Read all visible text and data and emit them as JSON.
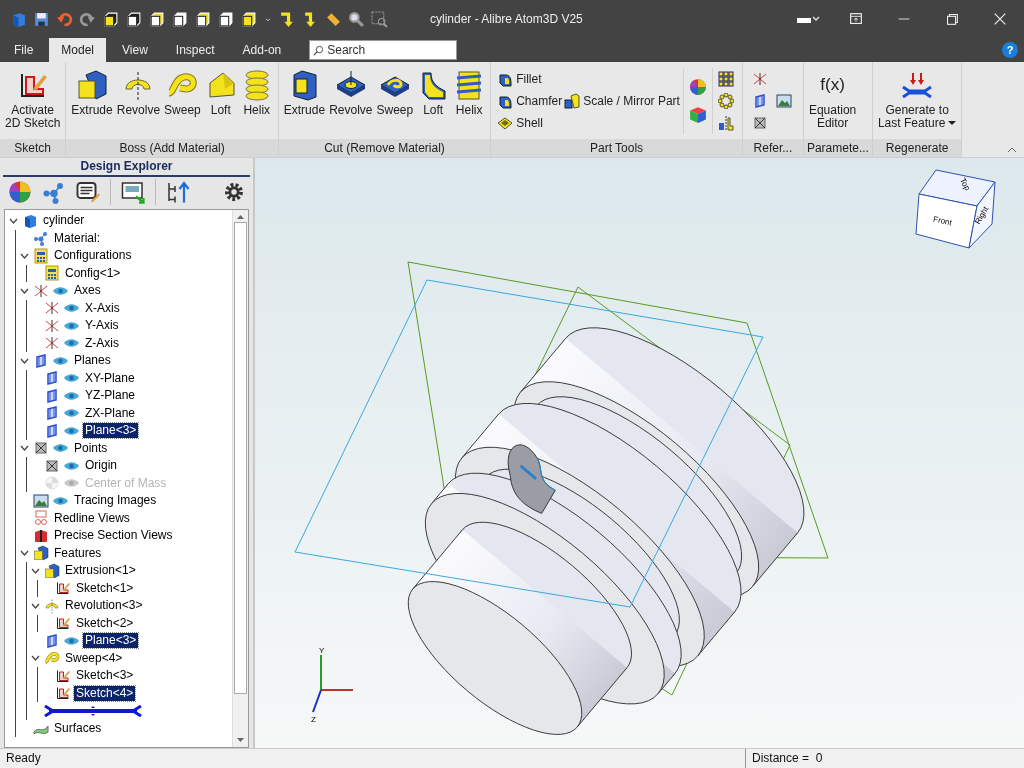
{
  "window": {
    "title": "cylinder - Alibre Atom3D V25"
  },
  "menu_tabs": [
    {
      "label": "File",
      "selected": false
    },
    {
      "label": "Model",
      "selected": true
    },
    {
      "label": "View",
      "selected": false
    },
    {
      "label": "Inspect",
      "selected": false
    },
    {
      "label": "Add-on",
      "selected": false
    }
  ],
  "search": {
    "placeholder": "Search"
  },
  "help": {
    "label": "?"
  },
  "ribbon_groups": [
    {
      "label": "Sketch",
      "kind": "large",
      "buttons": [
        {
          "label": "Activate\n2D Sketch"
        }
      ]
    },
    {
      "label": "Boss (Add Material)",
      "kind": "large",
      "buttons": [
        {
          "label": "Extrude"
        },
        {
          "label": "Revolve"
        },
        {
          "label": "Sweep"
        },
        {
          "label": "Loft"
        },
        {
          "label": "Helix"
        }
      ]
    },
    {
      "label": "Cut (Remove Material)",
      "kind": "large",
      "buttons": [
        {
          "label": "Extrude"
        },
        {
          "label": "Revolve"
        },
        {
          "label": "Sweep"
        },
        {
          "label": "Loft"
        },
        {
          "label": "Helix"
        }
      ]
    },
    {
      "label": "Part Tools",
      "kind": "tools",
      "buttons": [
        {
          "label": "Fillet"
        },
        {
          "label": "Chamfer"
        },
        {
          "label": "Scale / Mirror Part"
        },
        {
          "label": "Shell"
        }
      ]
    },
    {
      "label": "Refer...",
      "kind": "reference"
    },
    {
      "label": "Paramete...",
      "kind": "large",
      "buttons": [
        {
          "label": "Equation\nEditor",
          "icon_text": "f(x)"
        }
      ]
    },
    {
      "label": "Regenerate",
      "kind": "large",
      "buttons": [
        {
          "label": "Generate to\nLast Feature",
          "dropdown": true
        }
      ]
    }
  ],
  "design_explorer": {
    "title": "Design Explorer",
    "tree": [
      {
        "label": "cylinder",
        "kind": "part",
        "eye": false,
        "disabled": false,
        "selected": false,
        "expanded": true,
        "children": [
          {
            "label": "Material:",
            "kind": "material",
            "eye": false,
            "disabled": false,
            "selected": false
          },
          {
            "label": "Configurations",
            "kind": "config",
            "eye": false,
            "disabled": false,
            "selected": false,
            "expanded": true,
            "children": [
              {
                "label": "Config<1>",
                "kind": "config",
                "eye": false,
                "disabled": false,
                "selected": false
              }
            ]
          },
          {
            "label": "Axes",
            "kind": "axis",
            "eye": true,
            "disabled": false,
            "selected": false,
            "expanded": true,
            "children": [
              {
                "label": "X-Axis",
                "kind": "axis",
                "eye": true,
                "disabled": false,
                "selected": false
              },
              {
                "label": "Y-Axis",
                "kind": "axis",
                "eye": true,
                "disabled": false,
                "selected": false
              },
              {
                "label": "Z-Axis",
                "kind": "axis",
                "eye": true,
                "disabled": false,
                "selected": false
              }
            ]
          },
          {
            "label": "Planes",
            "kind": "plane",
            "eye": true,
            "disabled": false,
            "selected": false,
            "expanded": true,
            "children": [
              {
                "label": "XY-Plane",
                "kind": "plane",
                "eye": true,
                "disabled": false,
                "selected": false
              },
              {
                "label": "YZ-Plane",
                "kind": "plane",
                "eye": true,
                "disabled": false,
                "selected": false
              },
              {
                "label": "ZX-Plane",
                "kind": "plane",
                "eye": true,
                "disabled": false,
                "selected": false
              },
              {
                "label": "Plane<3>",
                "kind": "plane",
                "eye": true,
                "disabled": false,
                "selected": true
              }
            ]
          },
          {
            "label": "Points",
            "kind": "point",
            "eye": true,
            "disabled": false,
            "selected": false,
            "expanded": true,
            "children": [
              {
                "label": "Origin",
                "kind": "point",
                "eye": true,
                "disabled": false,
                "selected": false
              },
              {
                "label": "Center of Mass",
                "kind": "mass",
                "eye": true,
                "disabled": true,
                "selected": false
              }
            ]
          },
          {
            "label": "Tracing Images",
            "kind": "image",
            "eye": true,
            "disabled": false,
            "selected": false
          },
          {
            "label": "Redline Views",
            "kind": "redline",
            "eye": false,
            "disabled": false,
            "selected": false
          },
          {
            "label": "Precise Section Views",
            "kind": "section",
            "eye": false,
            "disabled": false,
            "selected": false
          },
          {
            "label": "Features",
            "kind": "extrude",
            "eye": false,
            "disabled": false,
            "selected": false,
            "expanded": true,
            "rollback_marker": true,
            "children": [
              {
                "label": "Extrusion<1>",
                "kind": "extrude",
                "eye": false,
                "disabled": false,
                "selected": false,
                "expanded": true,
                "children": [
                  {
                    "label": "Sketch<1>",
                    "kind": "sketch",
                    "eye": false,
                    "disabled": false,
                    "selected": false
                  }
                ]
              },
              {
                "label": "Revolution<3>",
                "kind": "revolve",
                "eye": false,
                "disabled": false,
                "selected": false,
                "expanded": true,
                "children": [
                  {
                    "label": "Sketch<2>",
                    "kind": "sketch",
                    "eye": false,
                    "disabled": false,
                    "selected": false
                  }
                ]
              },
              {
                "label": "Plane<3>",
                "kind": "plane",
                "eye": true,
                "disabled": false,
                "selected": true
              },
              {
                "label": "Sweep<4>",
                "kind": "sweep",
                "eye": false,
                "disabled": false,
                "selected": false,
                "expanded": true,
                "children": [
                  {
                    "label": "Sketch<3>",
                    "kind": "sketch",
                    "eye": false,
                    "disabled": false,
                    "selected": false
                  },
                  {
                    "label": "Sketch<4>",
                    "kind": "sketch",
                    "eye": false,
                    "disabled": false,
                    "selected": true
                  }
                ]
              }
            ]
          },
          {
            "label": "Surfaces",
            "kind": "surface",
            "eye": false,
            "disabled": false,
            "selected": false
          }
        ]
      }
    ]
  },
  "viewport": {
    "view_cube": {
      "top": "Top",
      "front": "Front",
      "right": "Right"
    },
    "triad": {
      "y": "Y",
      "z": "Z"
    }
  },
  "status_bar": {
    "message": "Ready",
    "distance": "Distance =  0"
  }
}
